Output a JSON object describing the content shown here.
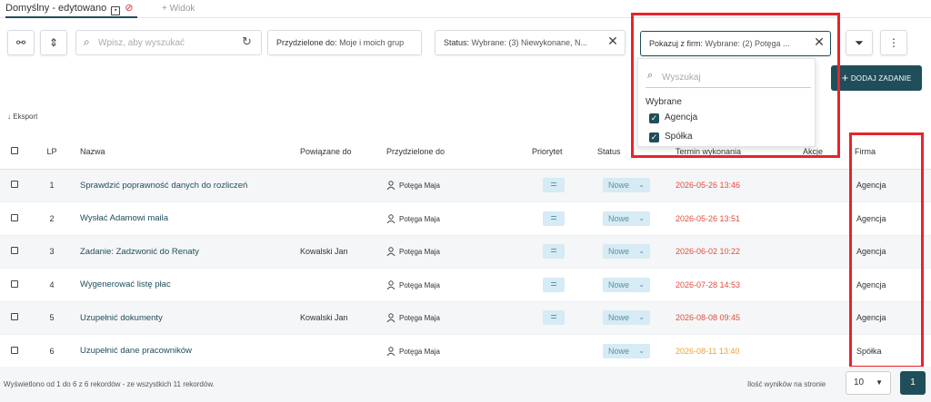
{
  "tabs": {
    "active": "Domyślny - edytowano",
    "add": "+ Widok"
  },
  "toolbar": {
    "search_placeholder": "Wpisz, aby wyszukać",
    "assigned_label": "Przydzielone do:",
    "assigned_value": "Moje i moich grup",
    "status_label": "Status:",
    "status_value": "Wybrane: (3) Niewykonane, N...",
    "firms_label": "Pokazuj z firm:",
    "firms_value": "Wybrane: (2) Potęga ...",
    "add_task": "DODAJ ZADANIE"
  },
  "dropdown": {
    "search_placeholder": "Wyszukaj",
    "section": "Wybrane",
    "options": [
      "Agencja",
      "Spółka"
    ]
  },
  "export": "Eksport",
  "columns": {
    "lp": "LP",
    "name": "Nazwa",
    "related": "Powiązane do",
    "assigned": "Przydzielone do",
    "priority": "Priorytet",
    "status": "Status",
    "due": "Termin wykonania",
    "actions": "Akcje",
    "firm": "Firma"
  },
  "rows": [
    {
      "lp": "1",
      "name": "Sprawdzić poprawność danych do rozliczeń",
      "related": "",
      "assigned": "Potęga Maja",
      "status": "Nowe",
      "due": "2026-05-26 13:46",
      "firm": "Agencja"
    },
    {
      "lp": "2",
      "name": "Wysłać Adamowi maila",
      "related": "",
      "assigned": "Potęga Maja",
      "status": "Nowe",
      "due": "2026-05-26 13:51",
      "firm": "Agencja"
    },
    {
      "lp": "3",
      "name": "Zadanie: Zadzwonić do Renaty",
      "related": "Kowalski Jan",
      "assigned": "Potęga Maja",
      "status": "Nowe",
      "due": "2026-06-02 10:22",
      "firm": "Agencja"
    },
    {
      "lp": "4",
      "name": "Wygenerować listę płac",
      "related": "",
      "assigned": "Potęga Maja",
      "status": "Nowe",
      "due": "2026-07-28 14:53",
      "firm": "Agencja"
    },
    {
      "lp": "5",
      "name": "Uzupełnić dokumenty",
      "related": "Kowalski Jan",
      "assigned": "Potęga Maja",
      "status": "Nowe",
      "due": "2026-08-08 09:45",
      "firm": "Agencja"
    },
    {
      "lp": "6",
      "name": "Uzupełnić dane pracowników",
      "related": "",
      "assigned": "Potęga Maja",
      "status": "Nowe",
      "due": "2026-08-11 13:40",
      "firm": "Spółka"
    }
  ],
  "footer": {
    "summary": "Wyświetlono od 1 do 6 z 6 rekordów - ze wszystkich 11 rekordów.",
    "per_page_label": "Ilość wyników na stronie",
    "per_page": "10",
    "page": "1"
  },
  "colors": {
    "accent": "#1f4e5a",
    "highlight": "#e8232b",
    "overdue": "#e64c3c",
    "upcoming": "#f0a030"
  }
}
